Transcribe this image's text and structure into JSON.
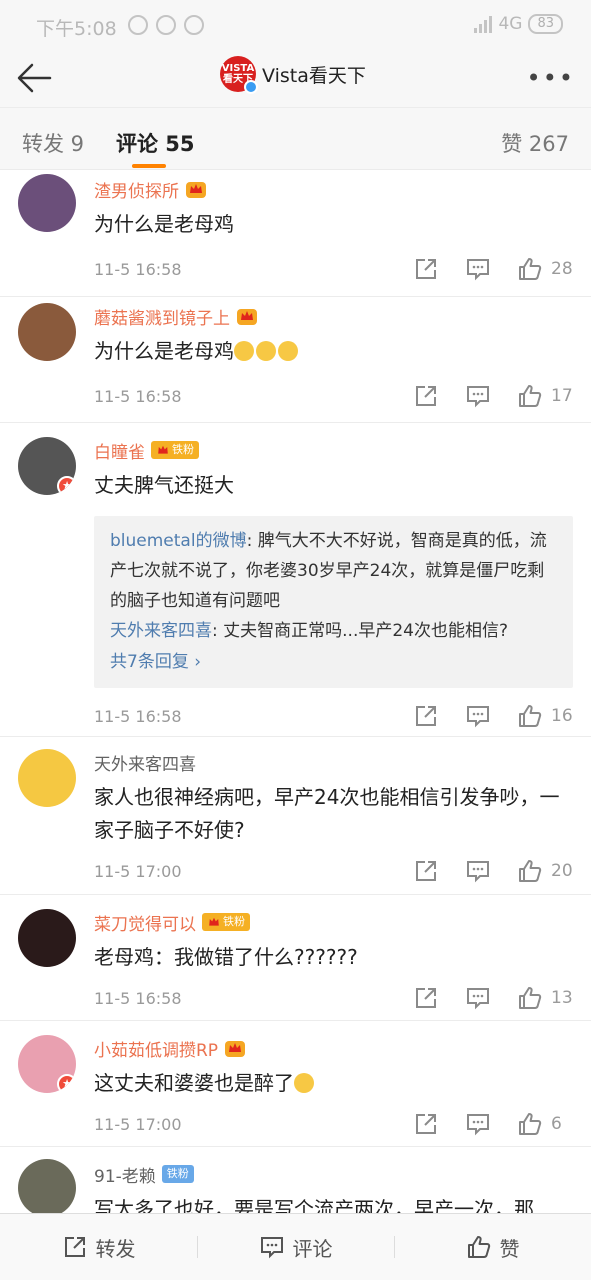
{
  "status": {
    "time": "下午5:08",
    "network": "4G",
    "battery": "83"
  },
  "nav": {
    "title": "Vista看天下",
    "logo_top": "VISTA",
    "logo_bottom": "看天下",
    "more": "•••"
  },
  "tabs": {
    "repost": "转发 9",
    "comment": "评论 55",
    "like": "赞 267"
  },
  "comments": [
    {
      "user": "渣男侦探所",
      "text": "为什么是老母鸡",
      "time": "11-5 16:58",
      "likes": "28",
      "avatar_color": "#6b4f7a"
    },
    {
      "user": "蘑菇酱溅到镜子上",
      "text": "为什么是老母鸡",
      "time": "11-5 16:58",
      "likes": "17",
      "avatar_color": "#8a5a3c"
    },
    {
      "user": "白瞳雀",
      "badge": "铁粉",
      "text": "丈夫脾气还挺大",
      "time": "11-5 16:58",
      "likes": "16",
      "avatar_color": "#555555",
      "replies": [
        {
          "name": "bluemetal的微博",
          "text": ": 脾气大不大不好说，智商是真的低，流产七次就不说了，你老婆30岁早产24次，就算是僵尸吃剩的脑子也知道有问题吧"
        },
        {
          "name": "天外来客四喜",
          "text": ": 丈夫智商正常吗...早产24次也能相信?"
        }
      ],
      "more_replies": "共7条回复 ›"
    },
    {
      "user": "天外来客四喜",
      "text": "家人也很神经病吧，早产24次也能相信引发争吵，一家子脑子不好使?",
      "time": "11-5 17:00",
      "likes": "20",
      "avatar_color": "#f5c842"
    },
    {
      "user": "菜刀觉得可以",
      "badge": "铁粉",
      "text": "老母鸡：我做错了什么??????",
      "time": "11-5 16:58",
      "likes": "13",
      "avatar_color": "#2a1a1a"
    },
    {
      "user": "小茹茹低调攒RP",
      "text": "这丈夫和婆婆也是醉了",
      "time": "11-5 17:00",
      "likes": "6",
      "avatar_color": "#e9a0b0"
    },
    {
      "user": "91-老赖",
      "badge": "铁粉",
      "text": "写太多了也好，要是写个流产两次，早产一次，那",
      "avatar_color": "#6a6a5a"
    }
  ],
  "bottom": {
    "repost": "转发",
    "comment": "评论",
    "like": "赞"
  },
  "colors": {
    "accent": "#ff8200",
    "username": "#eb7350",
    "link": "#507daf"
  }
}
